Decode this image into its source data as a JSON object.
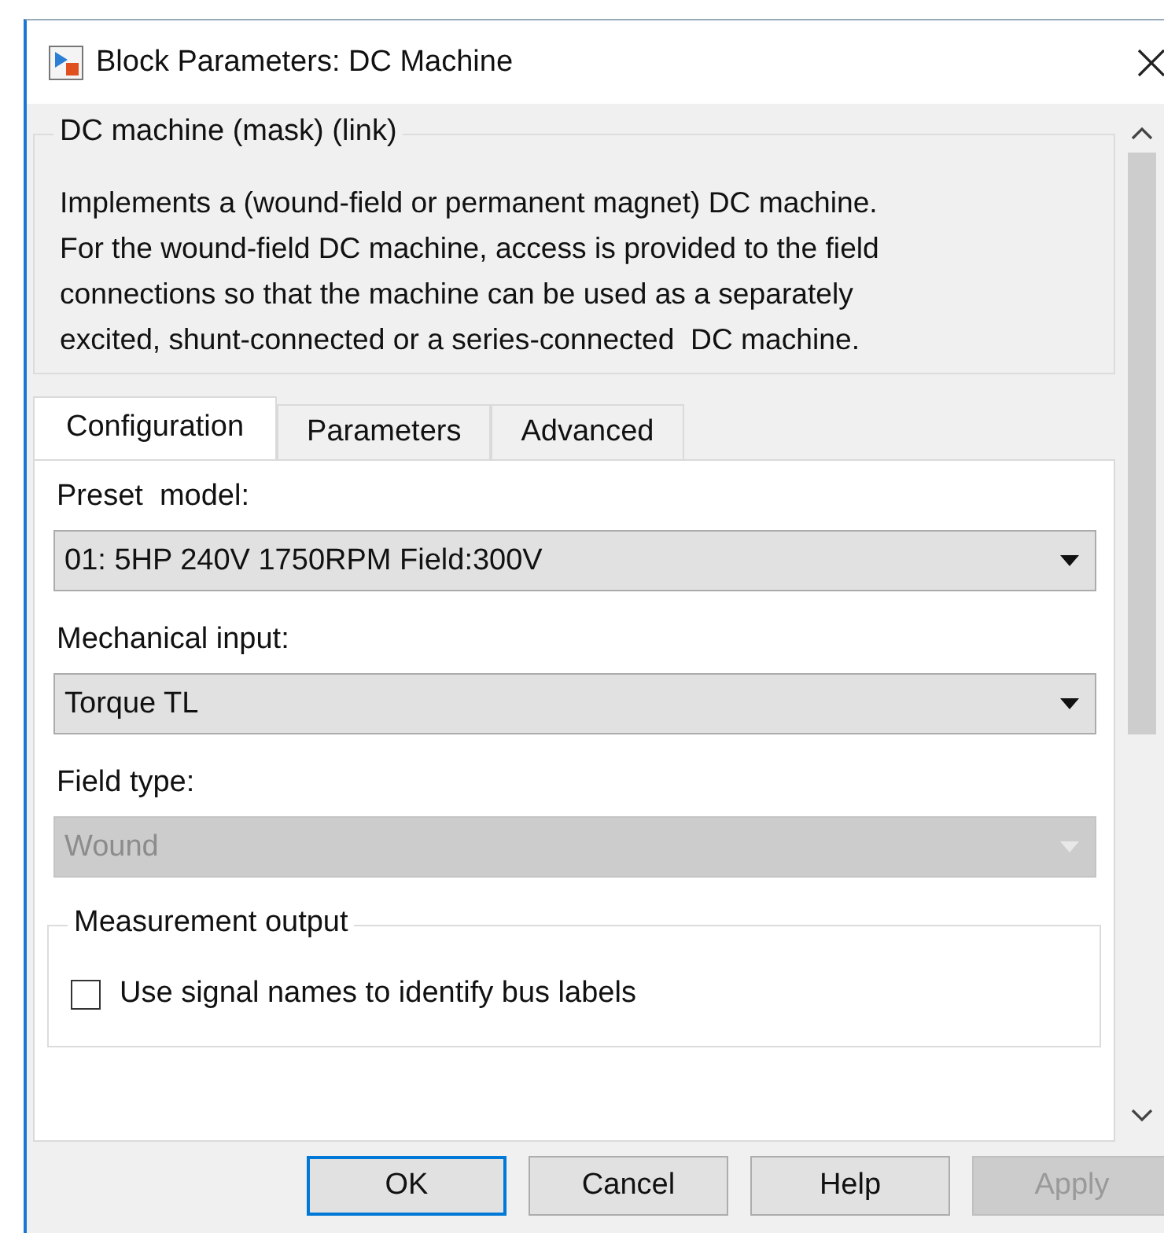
{
  "window": {
    "title": "Block Parameters: DC Machine"
  },
  "description": {
    "title": "DC machine (mask) (link)",
    "text": "Implements a (wound-field or permanent magnet) DC machine.\nFor the wound-field DC machine, access is provided to the field\nconnections so that the machine can be used as a separately\nexcited, shunt-connected or a series-connected  DC machine."
  },
  "tabs": [
    {
      "label": "Configuration",
      "selected": true
    },
    {
      "label": "Parameters",
      "selected": false
    },
    {
      "label": "Advanced",
      "selected": false
    }
  ],
  "fields": [
    {
      "label": "Preset  model:",
      "value": "01: 5HP 240V 1750RPM Field:300V",
      "disabled": false
    },
    {
      "label": "Mechanical input:",
      "value": "Torque TL",
      "disabled": false
    },
    {
      "label": "Field type:",
      "value": "Wound",
      "disabled": true
    }
  ],
  "measurement": {
    "title": "Measurement output",
    "option": {
      "label": "Use signal names to identify bus labels",
      "checked": false
    }
  },
  "buttons": [
    {
      "label": "OK",
      "disabled": false,
      "default": true
    },
    {
      "label": "Cancel",
      "disabled": false,
      "default": false
    },
    {
      "label": "Help",
      "disabled": false,
      "default": false
    },
    {
      "label": "Apply",
      "disabled": true,
      "default": false
    }
  ]
}
